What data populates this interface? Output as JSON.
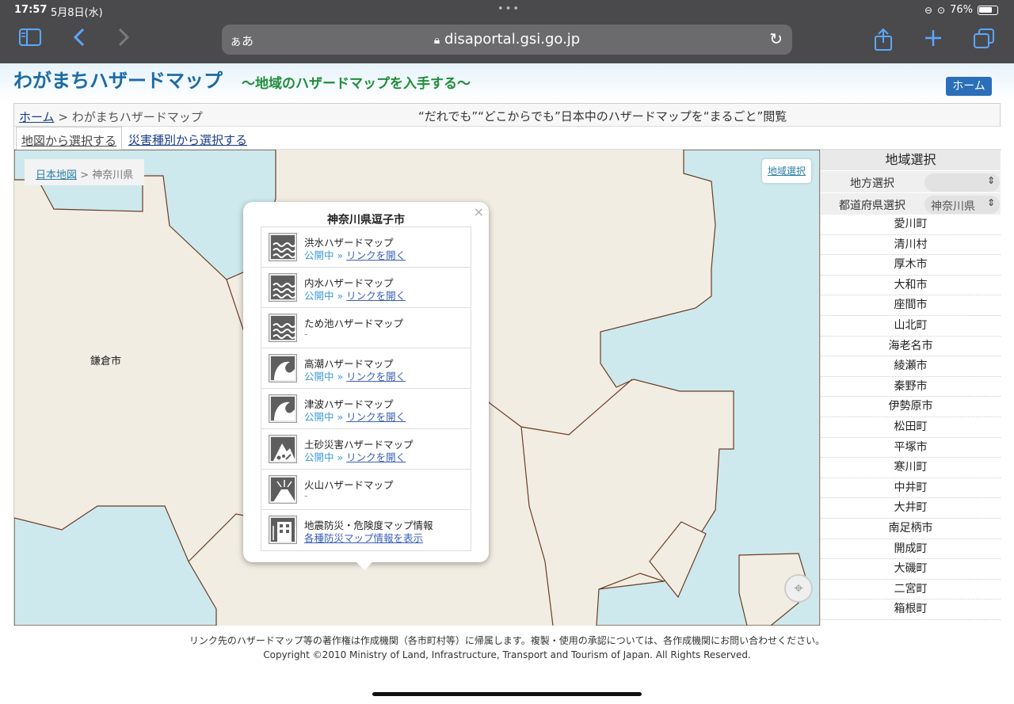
{
  "status_bar": {
    "time": "17:57",
    "date": "5月8日(水)",
    "dots": "•••",
    "battery": "76%"
  },
  "browser": {
    "text_size": "ぁあ",
    "url": "disaportal.gsi.go.jp"
  },
  "site": {
    "title": "わがまちハザードマップ",
    "subtitle": "〜地域のハザードマップを入手する〜",
    "home_button": "ホーム"
  },
  "breadcrumb": {
    "home": "ホーム",
    "separator": ">",
    "current": "わがまちハザードマップ"
  },
  "slogan": "“だれでも”“どこからでも”日本中のハザードマップを“まるごと”閲覧",
  "tabs": [
    {
      "label": "地図から選択する"
    },
    {
      "label": "災害種別から選択する"
    }
  ],
  "map": {
    "crumb_root": "日本地図",
    "crumb_separator": ">",
    "crumb_current": "神奈川県",
    "region_button": "地域選択",
    "city_label": "鎌倉市",
    "colors": {
      "land": "#f2ede3",
      "sea": "#cde9ee",
      "border": "#6b3d24"
    }
  },
  "popup": {
    "title": "神奈川県逗子市",
    "close": "×",
    "items": [
      {
        "name": "洪水ハザードマップ",
        "status": "公開中",
        "link": "リンクを開く",
        "icon": "flood-icon"
      },
      {
        "name": "内水ハザードマップ",
        "status": "公開中",
        "link": "リンクを開く",
        "icon": "inland-flood-icon"
      },
      {
        "name": "ため池ハザードマップ",
        "status": "-",
        "link": "",
        "icon": "reservoir-icon"
      },
      {
        "name": "高潮ハザードマップ",
        "status": "公開中",
        "link": "リンクを開く",
        "icon": "storm-surge-icon"
      },
      {
        "name": "津波ハザードマップ",
        "status": "公開中",
        "link": "リンクを開く",
        "icon": "tsunami-icon"
      },
      {
        "name": "土砂災害ハザードマップ",
        "status": "公開中",
        "link": "リンクを開く",
        "icon": "landslide-icon"
      },
      {
        "name": "火山ハザードマップ",
        "status": "-",
        "link": "",
        "icon": "volcano-icon"
      },
      {
        "name": "地震防災・危険度マップ情報",
        "status": "",
        "link": "各種防災マップ情報を表示",
        "icon": "earthquake-building-icon"
      }
    ],
    "link_arrow": "»"
  },
  "sidebar": {
    "title": "地域選択",
    "region_label": "地方選択",
    "region_value": "",
    "prefecture_label": "都道府県選択",
    "prefecture_value": "神奈川県",
    "municipalities": [
      "愛川町",
      "清川村",
      "厚木市",
      "大和市",
      "座間市",
      "山北町",
      "海老名市",
      "綾瀬市",
      "秦野市",
      "伊勢原市",
      "松田町",
      "平塚市",
      "寒川町",
      "中井町",
      "大井町",
      "南足柄市",
      "開成町",
      "大磯町",
      "二宮町",
      "箱根町"
    ]
  },
  "footer": {
    "line1": "リンク先のハザードマップ等の著作権は作成機関（各市町村等）に帰属します。複製・使用の承認については、各作成機関にお問い合わせください。",
    "line2": "Copyright ©2010 Ministry of Land, Infrastructure, Transport and Tourism of Japan. All Rights Reserved."
  }
}
